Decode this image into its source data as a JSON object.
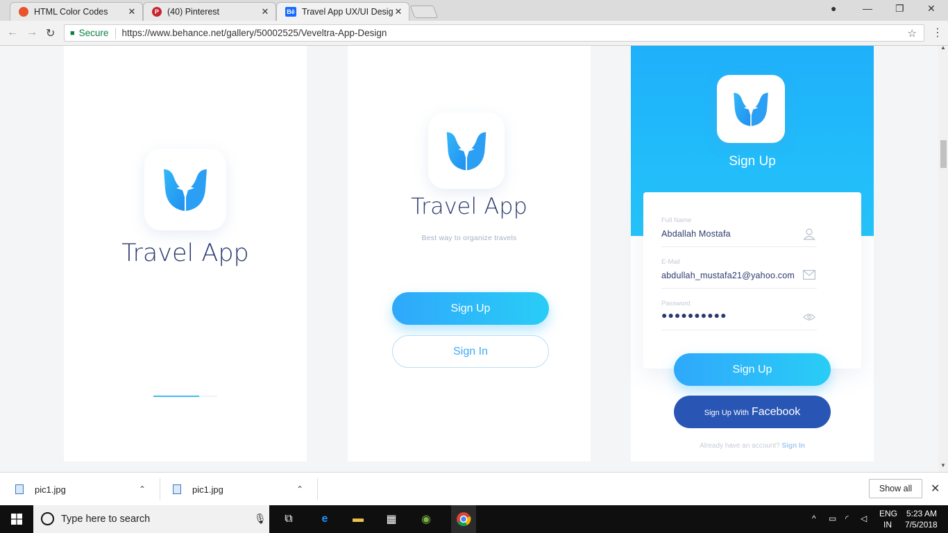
{
  "browser": {
    "tabs": [
      {
        "title": "HTML Color Codes",
        "favicon": "html-color-codes-icon",
        "color": "#e9522c"
      },
      {
        "title": "(40) Pinterest",
        "favicon": "pinterest-icon",
        "color": "#c8232c"
      },
      {
        "title": "Travel App UX/UI Design",
        "favicon": "behance-icon",
        "color": "#1769ff",
        "favicon_text": "Bē"
      }
    ],
    "secure_label": "Secure",
    "url": "https://www.behance.net/gallery/50002525/Veveltra-App-Design"
  },
  "screen1": {
    "brand": "Travel App",
    "progress": 0.72,
    "accent": "#43b8f5"
  },
  "screen2": {
    "brand": "Travel App",
    "tagline": "Best way to organize travels",
    "signup_label": "Sign Up",
    "signin_label": "Sign In"
  },
  "screen3": {
    "title": "Sign Up",
    "fields": [
      {
        "label": "Full Name",
        "value": "Abdallah Mostafa",
        "icon": "user-icon"
      },
      {
        "label": "E-Mail",
        "value": "abdullah_mustafa21@yahoo.com",
        "icon": "mail-icon"
      },
      {
        "label": "Password",
        "value": "●●●●●●●●●●",
        "icon": "eye-icon"
      }
    ],
    "signup_label": "Sign Up",
    "facebook_prefix": "Sign Up With",
    "facebook_label": "Facebook",
    "already_text": "Already have an account?",
    "signin_link": "Sign In",
    "header_color": "#1fb0fa",
    "facebook_color": "#2955b4"
  },
  "downloads": {
    "items": [
      {
        "name": "pic1.jpg"
      },
      {
        "name": "pic1.jpg"
      }
    ],
    "show_all": "Show all"
  },
  "taskbar": {
    "search_placeholder": "Type here to search",
    "lang_top": "ENG",
    "lang_bottom": "IN",
    "time": "5:23 AM",
    "date": "7/5/2018"
  }
}
